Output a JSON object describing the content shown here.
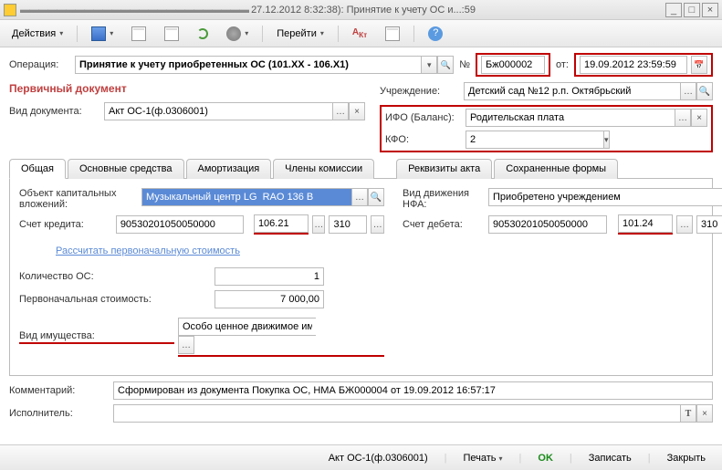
{
  "titlebar": {
    "prefix": "27.12.2012 8:32:38): Принятие к учету ОС и...:59"
  },
  "toolbar": {
    "actions": "Действия",
    "goto": "Перейти"
  },
  "header": {
    "operation_lbl": "Операция:",
    "operation_val": "Принятие к учету приобретенных ОС (101.ХХ - 106.Х1)",
    "number_lbl": "№",
    "number_val": "Бж000002",
    "date_lbl": "от:",
    "date_val": "19.09.2012 23:59:59"
  },
  "primary_doc": "Первичный документ",
  "left": {
    "doc_type_lbl": "Вид документа:",
    "doc_type_val": "Акт ОС-1(ф.0306001)"
  },
  "right": {
    "institution_lbl": "Учреждение:",
    "institution_val": "Детский сад №12 р.п. Октябрьский",
    "ifo_lbl": "ИФО (Баланс):",
    "ifo_val": "Родительская плата",
    "kfo_lbl": "КФО:",
    "kfo_val": "2"
  },
  "tabs": {
    "general": "Общая",
    "os": "Основные средства",
    "amort": "Амортизация",
    "komiss": "Члены комиссии",
    "rekv": "Реквизиты акта",
    "saved": "Сохраненные формы"
  },
  "general_tab": {
    "obj_lbl": "Объект капитальных вложений:",
    "obj_val": "Музыкальный центр LG  RAO 136 B",
    "credit_lbl": "Счет кредита:",
    "credit_acct": "90530201050050000",
    "credit_code": "106.21",
    "credit_extra": "310",
    "calc_link": "Рассчитать первоначальную стоимость",
    "mov_lbl": "Вид движения НФА:",
    "mov_val": "Приобретено учреждением",
    "debit_lbl": "Счет дебета:",
    "debit_acct": "90530201050050000",
    "debit_code": "101.24",
    "debit_extra": "310",
    "qty_lbl": "Количество ОС:",
    "qty_val": "1",
    "cost_lbl": "Первоначальная стоимость:",
    "cost_val": "7 000,00",
    "prop_lbl": "Вид имущества:",
    "prop_val": "Особо ценное движимое имущество"
  },
  "footer": {
    "comment_lbl": "Комментарий:",
    "comment_val": "Сформирован из документа Покупка ОС, НМА БЖ000004 от 19.09.2012 16:57:17",
    "exec_lbl": "Исполнитель:"
  },
  "statusbar": {
    "act": "Акт ОС-1(ф.0306001)",
    "print": "Печать",
    "ok": "OK",
    "save": "Записать",
    "close": "Закрыть"
  }
}
